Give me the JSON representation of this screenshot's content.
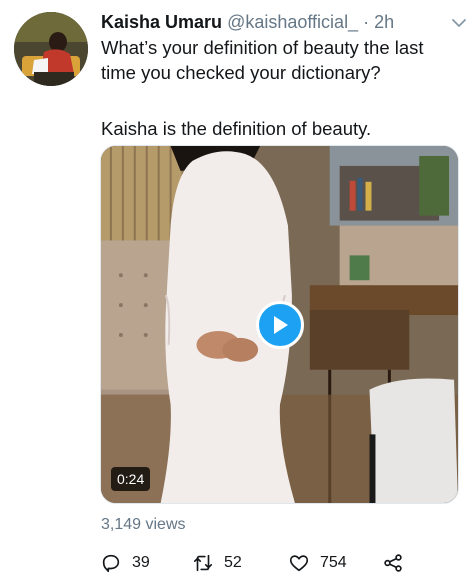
{
  "tweet": {
    "display_name": "Kaisha Umaru",
    "handle": "@kaishaofficial_",
    "separator": "·",
    "time": "2h",
    "text_line1": "What’s your definition of beauty the last time you checked your dictionary?",
    "text_line2": "Kaisha is the definition of beauty."
  },
  "media": {
    "duration": "0:24",
    "views": "3,149 views"
  },
  "actions": {
    "replies": "39",
    "retweets": "52",
    "likes": "754"
  },
  "icons": [
    "chevron-down-icon",
    "play-icon",
    "reply-icon",
    "retweet-icon",
    "like-icon",
    "share-icon"
  ],
  "colors": {
    "accent": "#1da1f2",
    "secondary_text": "#657786"
  }
}
